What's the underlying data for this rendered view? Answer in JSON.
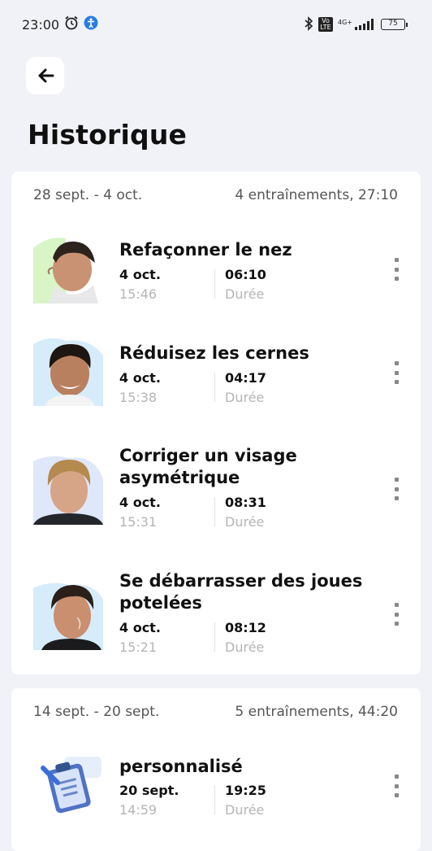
{
  "status": {
    "time": "23:00",
    "battery": "75",
    "network": "4G+",
    "volte": "Vo LTE"
  },
  "header": {
    "title": "Historique"
  },
  "weeks": [
    {
      "range": "28 sept. - 4 oct.",
      "summary": "4 entraînements, 27:10",
      "items": [
        {
          "title": "Refaçonner le nez",
          "date": "4 oct.",
          "time": "15:46",
          "duration": "06:10",
          "duration_label": "Durée"
        },
        {
          "title": "Réduisez les cernes",
          "date": "4 oct.",
          "time": "15:38",
          "duration": "04:17",
          "duration_label": "Durée"
        },
        {
          "title_line1": "Corriger un visage",
          "title_line2": "asymétrique",
          "date": "4 oct.",
          "time": "15:31",
          "duration": "08:31",
          "duration_label": "Durée"
        },
        {
          "title_line1": "Se débarrasser des joues",
          "title_line2": "potelées",
          "date": "4 oct.",
          "time": "15:21",
          "duration": "08:12",
          "duration_label": "Durée"
        }
      ]
    },
    {
      "range": "14 sept. - 20 sept.",
      "summary": "5 entraînements, 44:20",
      "items": [
        {
          "title": "personnalisé",
          "date": "20 sept.",
          "time": "14:59",
          "duration": "19:25",
          "duration_label": "Durée"
        }
      ]
    }
  ],
  "colors": {
    "background": "#f1f2f7",
    "card": "#ffffff",
    "muted": "#b5b5b8"
  }
}
